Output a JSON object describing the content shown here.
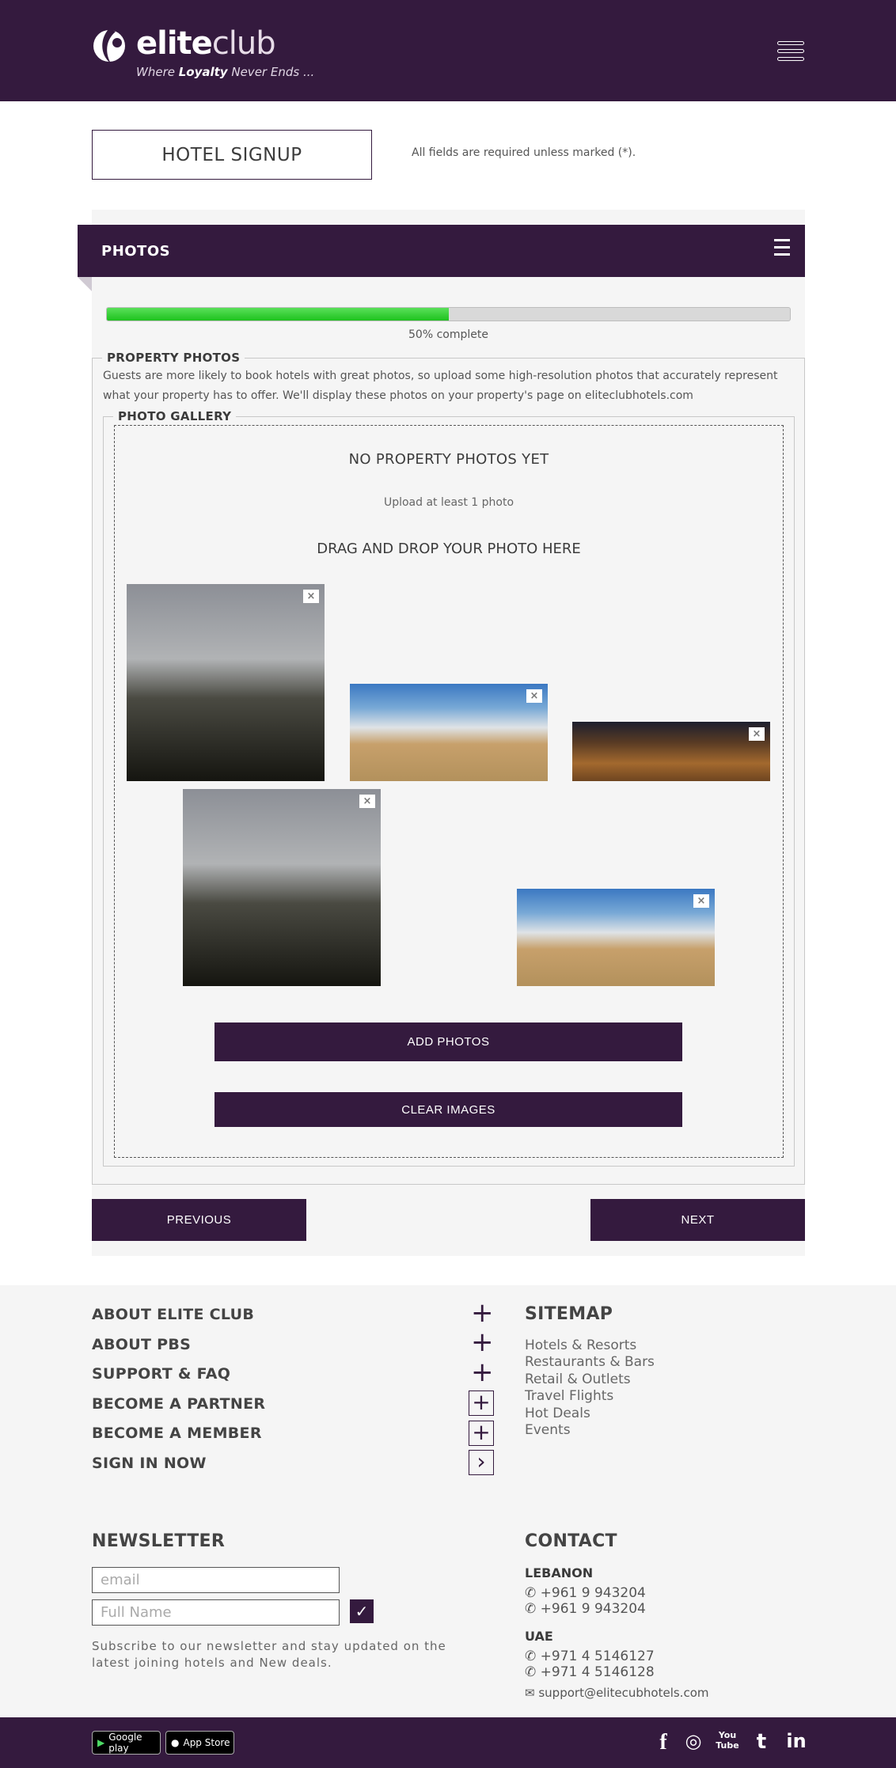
{
  "header": {
    "logo_main": "elite",
    "logo_club": "club",
    "tagline_pre": "Where ",
    "tagline_bold": "Loyalty",
    "tagline_post": " Never Ends ..."
  },
  "signup": {
    "title": "HOTEL SIGNUP",
    "required_note": "All fields are required unless marked (*)."
  },
  "section": {
    "title": "PHOTOS",
    "progress_percent": 50,
    "progress_label": "50% complete"
  },
  "property_photos": {
    "legend": "PROPERTY PHOTOS",
    "description": "Guests are more likely to book hotels with great photos, so upload some high-resolution photos that accurately represent what your property has to offer. We'll display these photos on your property's page on eliteclubhotels.com"
  },
  "gallery": {
    "legend": "PHOTO GALLERY",
    "empty_title": "NO PROPERTY PHOTOS YET",
    "upload_hint": "Upload at least 1 photo",
    "drag_drop": "DRAG AND DROP YOUR PHOTO HERE",
    "remove_glyph": "×",
    "add_button": "ADD PHOTOS",
    "clear_button": "CLEAR IMAGES"
  },
  "nav": {
    "previous": "PREVIOUS",
    "next": "NEXT"
  },
  "footer": {
    "links": [
      "ABOUT ELITE CLUB",
      "ABOUT PBS",
      "SUPPORT & FAQ",
      "BECOME A PARTNER",
      "BECOME A MEMBER",
      "SIGN IN NOW"
    ],
    "plus_glyph": "+",
    "arrow_glyph": "›",
    "sitemap_title": "SITEMAP",
    "sitemap": [
      "Hotels & Resorts",
      "Restaurants & Bars",
      "Retail & Outlets",
      "Travel Flights",
      "Hot Deals",
      "Events"
    ],
    "newsletter_title": "NEWSLETTER",
    "email_placeholder": "email",
    "name_placeholder": "Full Name",
    "check_glyph": "✓",
    "newsletter_desc": "Subscribe to our newsletter and stay updated on the latest joining hotels and New deals.",
    "contact_title": "CONTACT",
    "lebanon_label": "LEBANON",
    "lebanon_phones": [
      "+961 9 943204",
      "+961 9 943204"
    ],
    "uae_label": "UAE",
    "uae_phones": [
      "+971 4 5146127",
      "+971 4 5146128"
    ],
    "email": "support@elitecubhotels.com",
    "phone_glyph": "✆",
    "mail_glyph": "✉"
  },
  "bottom": {
    "google_play": "Google play",
    "app_store": "App Store",
    "social": [
      "f",
      "◎",
      "You Tube",
      "t",
      "in"
    ]
  },
  "colors": {
    "brand": "#341a3e",
    "progress": "#1ec21e",
    "panel": "#f5f5f5"
  }
}
